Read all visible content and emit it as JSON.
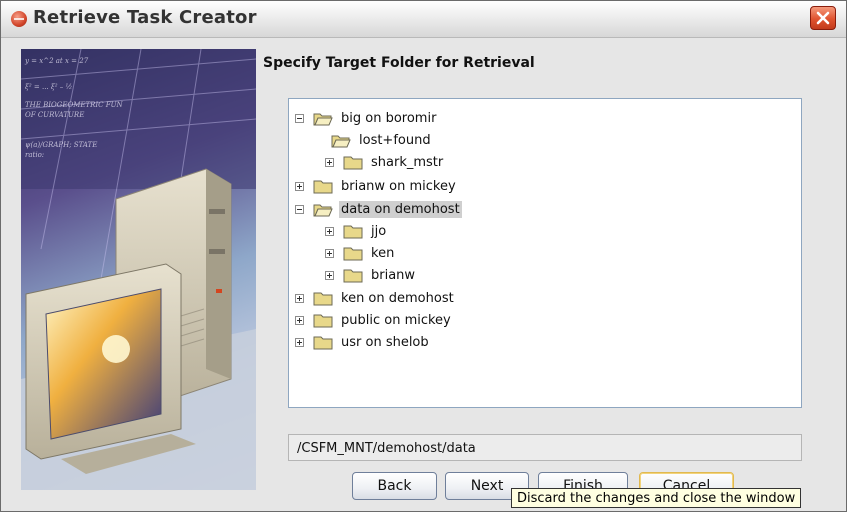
{
  "window": {
    "title": "Retrieve Task Creator"
  },
  "heading": "Specify Target Folder for Retrieval",
  "tree": [
    {
      "label": "big on boromir",
      "state": "expanded",
      "level": 0
    },
    {
      "label": "lost+found",
      "state": "leaf",
      "level": 1
    },
    {
      "label": "shark_mstr",
      "state": "collapsed",
      "level": 1
    },
    {
      "label": "brianw on mickey",
      "state": "collapsed",
      "level": 0
    },
    {
      "label": "data on demohost",
      "state": "expanded",
      "level": 0,
      "selected": true
    },
    {
      "label": "jjo",
      "state": "collapsed",
      "level": 1
    },
    {
      "label": "ken",
      "state": "collapsed",
      "level": 1
    },
    {
      "label": "brianw",
      "state": "collapsed",
      "level": 1
    },
    {
      "label": "ken on demohost",
      "state": "collapsed",
      "level": 0
    },
    {
      "label": "public on mickey",
      "state": "collapsed",
      "level": 0
    },
    {
      "label": "usr on shelob",
      "state": "collapsed",
      "level": 0
    }
  ],
  "path": "/CSFM_MNT/demohost/data",
  "buttons": {
    "back": "Back",
    "next": "Next",
    "finish": "Finish",
    "cancel": "Cancel"
  },
  "tooltip": "Discard the changes and close the window",
  "colors": {
    "folder_fill": "#e8d88a",
    "selection": "#cfcfcf",
    "close_button": "#e0532f"
  },
  "icons": {
    "app": "app-logo-icon",
    "close": "close-icon",
    "folder": "folder-icon",
    "open_folder": "folder-open-icon"
  }
}
